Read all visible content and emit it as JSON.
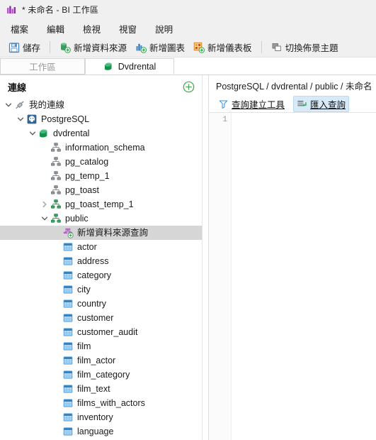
{
  "window": {
    "title": "* 未命名 - BI 工作區",
    "icon": "bar-chart-icon"
  },
  "menubar": {
    "items": [
      {
        "label": "檔案",
        "name": "menu-file"
      },
      {
        "label": "編輯",
        "name": "menu-edit"
      },
      {
        "label": "檢視",
        "name": "menu-view"
      },
      {
        "label": "視窗",
        "name": "menu-window"
      },
      {
        "label": "說明",
        "name": "menu-help"
      }
    ]
  },
  "toolbar": {
    "save_label": "儲存",
    "add_datasource_label": "新增資料來源",
    "add_chart_label": "新增圖表",
    "add_dashboard_label": "新增儀表板",
    "switch_theme_label": "切換佈景主題"
  },
  "tabs": [
    {
      "label": "工作區",
      "active": false,
      "icon": null
    },
    {
      "label": "Dvdrental",
      "active": true,
      "icon": "database-icon"
    }
  ],
  "connections_panel": {
    "title": "連線",
    "add_button_icon": "plus-circle-icon",
    "tree": [
      {
        "label": "我的連線",
        "depth": 0,
        "icon": "plug-icon",
        "twisty": "expanded",
        "selected": false
      },
      {
        "label": "PostgreSQL",
        "depth": 1,
        "icon": "postgres-icon",
        "twisty": "expanded",
        "selected": false
      },
      {
        "label": "dvdrental",
        "depth": 2,
        "icon": "database-icon",
        "twisty": "expanded",
        "selected": false
      },
      {
        "label": "information_schema",
        "depth": 3,
        "icon": "schema-gray-icon",
        "twisty": "none",
        "selected": false
      },
      {
        "label": "pg_catalog",
        "depth": 3,
        "icon": "schema-gray-icon",
        "twisty": "none",
        "selected": false
      },
      {
        "label": "pg_temp_1",
        "depth": 3,
        "icon": "schema-gray-icon",
        "twisty": "none",
        "selected": false
      },
      {
        "label": "pg_toast",
        "depth": 3,
        "icon": "schema-gray-icon",
        "twisty": "none",
        "selected": false
      },
      {
        "label": "pg_toast_temp_1",
        "depth": 3,
        "icon": "schema-green-icon",
        "twisty": "collapsed",
        "selected": false
      },
      {
        "label": "public",
        "depth": 3,
        "icon": "schema-green-icon",
        "twisty": "expanded",
        "selected": false
      },
      {
        "label": "新增資料來源查詢",
        "depth": 4,
        "icon": "new-query-icon",
        "twisty": "none",
        "selected": true
      },
      {
        "label": "actor",
        "depth": 4,
        "icon": "table-icon",
        "twisty": "none",
        "selected": false
      },
      {
        "label": "address",
        "depth": 4,
        "icon": "table-icon",
        "twisty": "none",
        "selected": false
      },
      {
        "label": "category",
        "depth": 4,
        "icon": "table-icon",
        "twisty": "none",
        "selected": false
      },
      {
        "label": "city",
        "depth": 4,
        "icon": "table-icon",
        "twisty": "none",
        "selected": false
      },
      {
        "label": "country",
        "depth": 4,
        "icon": "table-icon",
        "twisty": "none",
        "selected": false
      },
      {
        "label": "customer",
        "depth": 4,
        "icon": "table-icon",
        "twisty": "none",
        "selected": false
      },
      {
        "label": "customer_audit",
        "depth": 4,
        "icon": "table-icon",
        "twisty": "none",
        "selected": false
      },
      {
        "label": "film",
        "depth": 4,
        "icon": "table-icon",
        "twisty": "none",
        "selected": false
      },
      {
        "label": "film_actor",
        "depth": 4,
        "icon": "table-icon",
        "twisty": "none",
        "selected": false
      },
      {
        "label": "film_category",
        "depth": 4,
        "icon": "table-icon",
        "twisty": "none",
        "selected": false
      },
      {
        "label": "film_text",
        "depth": 4,
        "icon": "table-icon",
        "twisty": "none",
        "selected": false
      },
      {
        "label": "films_with_actors",
        "depth": 4,
        "icon": "table-icon",
        "twisty": "none",
        "selected": false
      },
      {
        "label": "inventory",
        "depth": 4,
        "icon": "table-icon",
        "twisty": "none",
        "selected": false
      },
      {
        "label": "language",
        "depth": 4,
        "icon": "table-icon",
        "twisty": "none",
        "selected": false
      }
    ]
  },
  "editor_panel": {
    "breadcrumb": "PostgreSQL / dvdrental / public / 未命名",
    "query_builder_label": "查詢建立工具",
    "import_query_label": "匯入查詢",
    "line_numbers": "1",
    "code": ""
  },
  "colors": {
    "chrome": "#f0f0f0",
    "selection": "#d6d6d6",
    "highlight_blue": "#d8eaf8",
    "accent_green": "#4caf50",
    "table_blue": "#3f95d8",
    "title_icon_purple": "#b046c8"
  }
}
